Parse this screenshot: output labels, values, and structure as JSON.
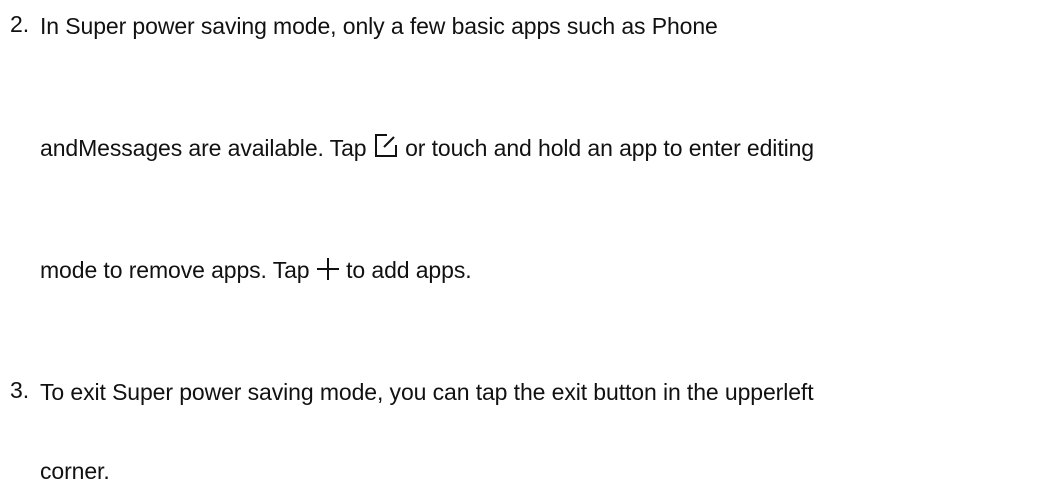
{
  "steps": [
    {
      "number": "2.",
      "line1": "In Super power saving mode, only a few basic apps such as Phone",
      "line2_before": "andMessages are available. Tap",
      "edit_icon": "edit-icon",
      "line2_after": "or touch and hold an app to enter editing",
      "line3_before": "mode to remove apps. Tap",
      "add_icon": "plus-icon",
      "line3_after": "to add apps."
    },
    {
      "number": "3.",
      "line1": "To exit Super power saving mode, you can tap the exit button in the upperleft",
      "line2": "corner."
    }
  ]
}
